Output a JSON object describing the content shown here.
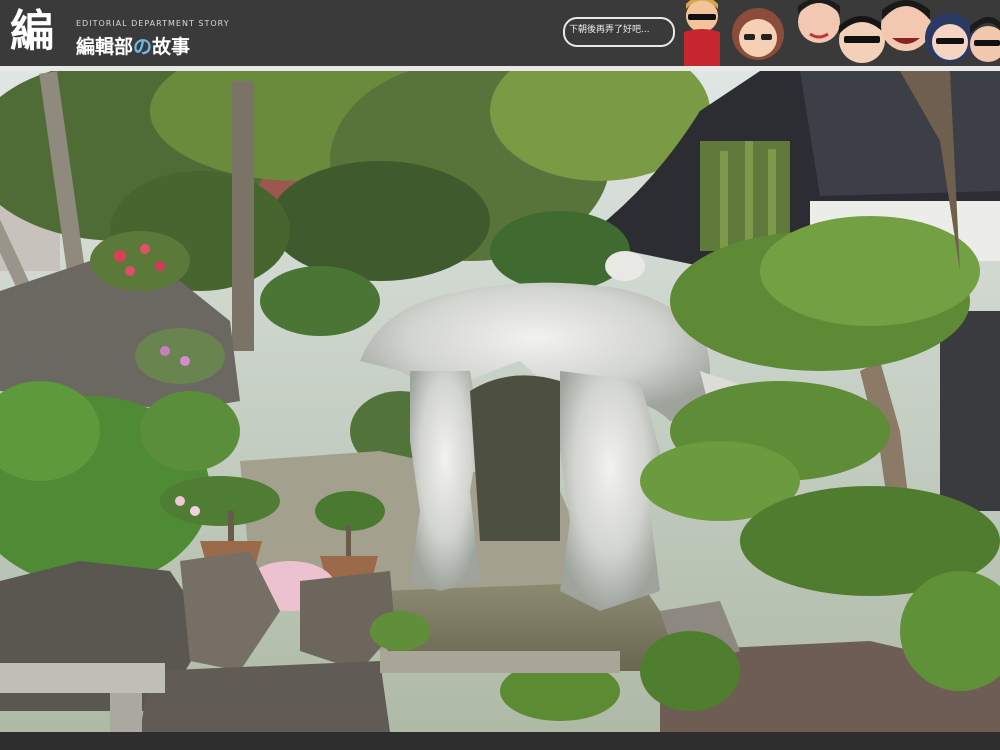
{
  "header": {
    "logo_glyph": "編",
    "tagline": "EDITORIAL DEPARTMENT STORY",
    "title_main": "編輯部",
    "title_no": "の",
    "title_end": "故事",
    "speech": "下朝後再弄了好吧..."
  },
  "photo": {
    "caption": ""
  }
}
